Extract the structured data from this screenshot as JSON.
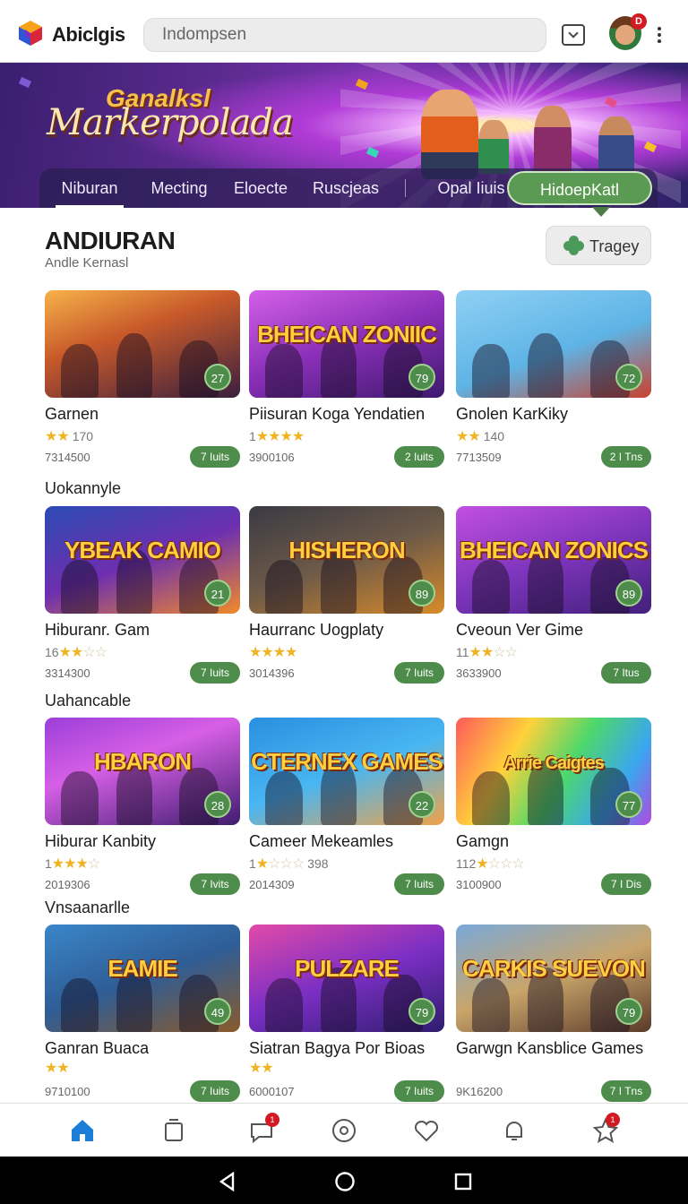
{
  "app": {
    "name": "Abiclgis"
  },
  "search": {
    "placeholder": "Indompsen"
  },
  "hero": {
    "kicker": "Ganalksl",
    "title": "Markerpolada"
  },
  "tabs": [
    {
      "label": "Niburan"
    },
    {
      "label": "Mecting"
    },
    {
      "label": "Eloecte"
    },
    {
      "label": "Ruscjeas"
    },
    {
      "label": "Opal Iiuis"
    },
    {
      "label": "HidoepKatl"
    }
  ],
  "section": {
    "title": "ANDIURAN",
    "subtitle": "Andle Kernasl",
    "filter_label": "Tragey"
  },
  "account": {
    "badge": "D"
  },
  "rows": [
    {
      "label": "",
      "cards": [
        {
          "title": "Garnen",
          "score": "27",
          "stars": 2,
          "rating": "170",
          "plays": "7314500",
          "pill": "7 Iuits"
        },
        {
          "title": "Piisuran Koga Yendatien",
          "score": "79",
          "stars": "1/4",
          "rating": "",
          "plays": "3900106",
          "pill": "2 Iuits"
        },
        {
          "title": "Gnolen KarKiky",
          "score": "72",
          "stars": 2,
          "rating": "140",
          "plays": "7713509",
          "pill": "2 I Tns"
        }
      ]
    },
    {
      "label": "Uokannyle",
      "cards": [
        {
          "title": "Hiburanr. Gam",
          "score": "21",
          "stars": "16/2",
          "rating": "",
          "plays": "3314300",
          "pill": "7 Iuits"
        },
        {
          "title": "Haurranc Uogplaty",
          "score": "89",
          "stars": 4,
          "rating": "",
          "plays": "3014396",
          "pill": "7 Iuits"
        },
        {
          "title": "Cveoun Ver Gime",
          "score": "89",
          "stars": "11/2",
          "rating": "",
          "plays": "3633900",
          "pill": "7 Itus"
        }
      ]
    },
    {
      "label": "Uahancable",
      "cards": [
        {
          "title": "Hiburar Kanbity",
          "score": "28",
          "stars": "1/3",
          "rating": "",
          "plays": "2019306",
          "pill": "7 Ivits"
        },
        {
          "title": "Cameer Mekeamles",
          "score": "22",
          "stars": "1/1",
          "rating": "398",
          "plays": "2014309",
          "pill": "7 Iuits"
        },
        {
          "title": "Gamgn",
          "score": "77",
          "stars": "112/1",
          "rating": "",
          "plays": "3100900",
          "pill": "7 I Dis"
        }
      ]
    },
    {
      "label": "Vnsaanarlle",
      "cards": [
        {
          "title": "Ganran Buaca",
          "score": "49",
          "stars": 2,
          "rating": "",
          "plays": "9710100",
          "pill": "7 Iuits"
        },
        {
          "title": "Siatran Bagya Por Bioas",
          "score": "79",
          "stars": 2,
          "rating": "",
          "plays": "6000107",
          "pill": "7 Iuits"
        },
        {
          "title": "Garwgn Kansblice Games",
          "score": "79",
          "stars": 0,
          "rating": "",
          "plays": "9K16200",
          "pill": "7 I Tns"
        }
      ]
    }
  ],
  "thumbs": [
    "",
    "BHEICAN ZONIIC",
    "",
    "YBEAK CAMIO",
    "HISHERON",
    "BHEICAN ZONICS",
    "HBARON",
    "CTERNEX GAMES",
    "Arrie Caigtes",
    "EAMIE",
    "PULZARE",
    "CARKIS SUEVON"
  ],
  "bottom_nav": [
    {
      "icon": "home-icon"
    },
    {
      "icon": "library-icon"
    },
    {
      "icon": "chat-icon",
      "badge": "1"
    },
    {
      "icon": "disc-icon"
    },
    {
      "icon": "heart-icon"
    },
    {
      "icon": "bell-icon"
    },
    {
      "icon": "star-icon",
      "badge": "1"
    }
  ],
  "colors": {
    "accent_green": "#4d8c4a",
    "hero_purple": "#5a2a8e",
    "badge_red": "#d21a22",
    "nav_blue": "#1c7ed6"
  }
}
